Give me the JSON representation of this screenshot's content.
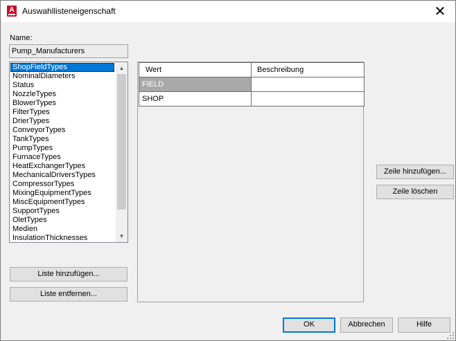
{
  "window": {
    "title": "Auswahllisteneigenschaft",
    "app_icon_letter": "A"
  },
  "name_label": "Name:",
  "name_value": "Pump_Manufacturers",
  "lists": [
    "ShopFieldTypes",
    "NominalDiameters",
    "Status",
    "NozzleTypes",
    "BlowerTypes",
    "FilterTypes",
    "DrierTypes",
    "ConveyorTypes",
    "TankTypes",
    "PumpTypes",
    "FurnaceTypes",
    "HeatExchangerTypes",
    "MechanicalDriversTypes",
    "CompressorTypes",
    "MixingEquipmentTypes",
    "MiscEquipmentTypes",
    "SupportTypes",
    "OletTypes",
    "Medien",
    "InsulationThicknesses"
  ],
  "selected_list_index": 0,
  "buttons": {
    "add_list": "Liste hinzufügen...",
    "remove_list": "Liste entfernen...",
    "add_row": "Zeile hinzufügen...",
    "delete_row": "Zeile löschen",
    "ok": "OK",
    "cancel": "Abbrechen",
    "help": "Hilfe"
  },
  "table": {
    "columns": [
      "Wert",
      "Beschreibung"
    ],
    "rows": [
      {
        "wert": "FIELD",
        "beschreibung": "",
        "selected": true
      },
      {
        "wert": "SHOP",
        "beschreibung": "",
        "selected": false
      }
    ]
  },
  "colors": {
    "selection": "#0078d7",
    "grid_selection": "#a9a9a9"
  }
}
